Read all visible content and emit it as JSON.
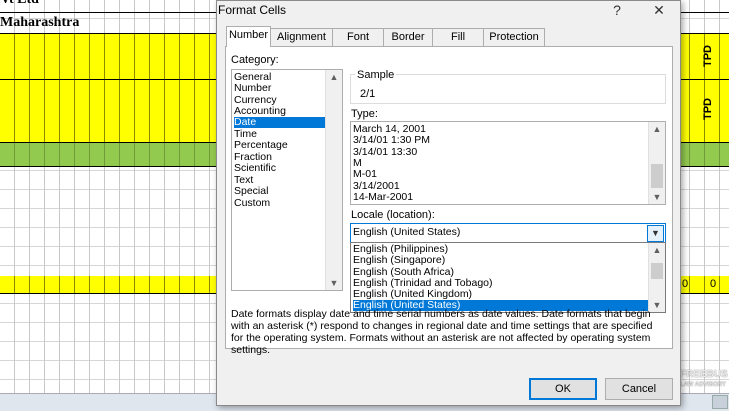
{
  "sheet": {
    "title_partial": "vt Ltd",
    "location_partial": "Maharashtra",
    "header_col_1": "TPD",
    "header_col_2": "TPD",
    "cell_value_1": "0",
    "cell_value_2": "0",
    "colors": {
      "yellow": "#ffff00",
      "green": "#92c94f"
    }
  },
  "watermark": {
    "line1": "FREEBUS",
    "line2": "LAW ADVISORY"
  },
  "dialog": {
    "title": "Format Cells",
    "help_label": "?",
    "close_label": "✕",
    "tabs": [
      {
        "label": "Number",
        "active": true
      },
      {
        "label": "Alignment"
      },
      {
        "label": "Font"
      },
      {
        "label": "Border"
      },
      {
        "label": "Fill"
      },
      {
        "label": "Protection"
      }
    ],
    "category_label": "Category:",
    "categories": [
      "General",
      "Number",
      "Currency",
      "Accounting",
      "Date",
      "Time",
      "Percentage",
      "Fraction",
      "Scientific",
      "Text",
      "Special",
      "Custom"
    ],
    "selected_category": "Date",
    "sample_label": "Sample",
    "sample_value": "2/1",
    "type_label": "Type:",
    "types": [
      "March 14, 2001",
      "3/14/01 1:30 PM",
      "3/14/01 13:30",
      "M",
      "M-01",
      "3/14/2001",
      "14-Mar-2001"
    ],
    "locale_label": "Locale (location):",
    "locale_value": "English (United States)",
    "locale_options": [
      "English (Philippines)",
      "English (Singapore)",
      "English (South Africa)",
      "English (Trinidad and Tobago)",
      "English (United Kingdom)",
      "English (United States)"
    ],
    "selected_locale": "English (United States)",
    "description": "Date formats display date and time serial numbers as date values.  Date formats that begin with an asterisk (*) respond to changes in regional date and time settings that are specified for the operating system. Formats without an asterisk are not affected by operating system settings.",
    "ok_label": "OK",
    "cancel_label": "Cancel",
    "accent_color": "#0078d7"
  }
}
